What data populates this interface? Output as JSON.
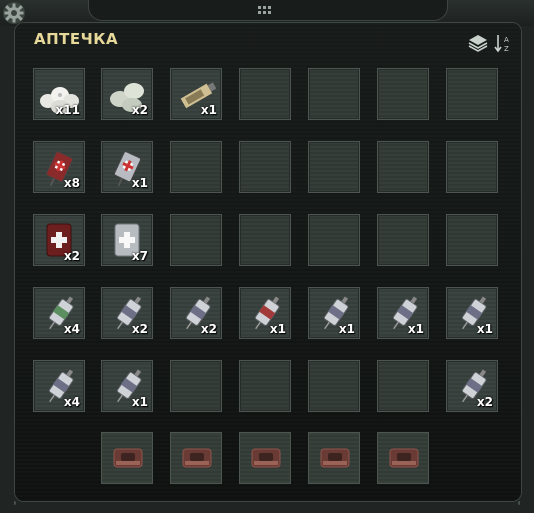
{
  "window": {
    "title": "АПТЕЧКА",
    "settings_icon": "gear-icon",
    "handle_icon": "drag-handle-icon",
    "stack_icon": "layers-icon",
    "sort_icon": "sort-az-icon",
    "sort_label": "A\nZ"
  },
  "colors": {
    "title": "#e7d99a",
    "slot": "#37403b",
    "panel": "#0f1211"
  },
  "inventory": {
    "rows": [
      [
        {
          "icon": "bandage-rolls-icon",
          "qty": "x11"
        },
        {
          "icon": "elastic-bandage-icon",
          "qty": "x2"
        },
        {
          "icon": "tube-icon",
          "qty": "x1"
        },
        null,
        null,
        null,
        null
      ],
      [
        {
          "icon": "blood-bag-icon",
          "qty": "x8"
        },
        {
          "icon": "saline-bag-icon",
          "qty": "x1"
        },
        null,
        null,
        null,
        null,
        null
      ],
      [
        {
          "icon": "medkit-red-icon",
          "qty": "x2"
        },
        {
          "icon": "medkit-white-icon",
          "qty": "x7"
        },
        null,
        null,
        null,
        null,
        null
      ],
      [
        {
          "icon": "injector-sta-icon",
          "qty": "x4"
        },
        {
          "icon": "injector-icon",
          "qty": "x2"
        },
        {
          "icon": "injector-icon",
          "qty": "x2"
        },
        {
          "icon": "injector-ma-icon",
          "qty": "x1"
        },
        {
          "icon": "injector-icon",
          "qty": "x1"
        },
        {
          "icon": "injector-icon",
          "qty": "x1"
        },
        {
          "icon": "injector-icon",
          "qty": "x1"
        }
      ],
      [
        {
          "icon": "injector-icon",
          "qty": "x4"
        },
        {
          "icon": "injector-icon",
          "qty": "x1"
        },
        null,
        null,
        null,
        null,
        {
          "icon": "injector-icon",
          "qty": "x2"
        }
      ]
    ],
    "quick_slots": [
      {
        "icon": "quick-slot-icon"
      },
      {
        "icon": "quick-slot-icon"
      },
      {
        "icon": "quick-slot-icon"
      },
      {
        "icon": "quick-slot-icon"
      },
      {
        "icon": "quick-slot-icon"
      }
    ]
  }
}
